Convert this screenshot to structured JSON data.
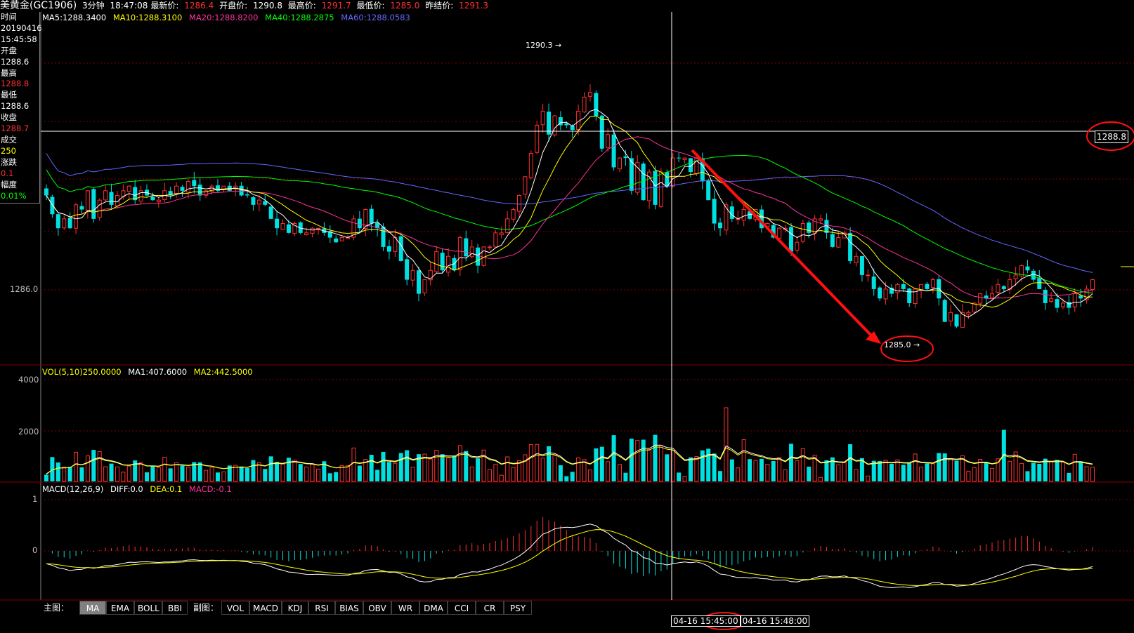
{
  "header": {
    "title": "美黄金(GC1906)",
    "period": "3分钟",
    "time": "18:47:08",
    "latest_label": "最新价:",
    "latest": "1286.4",
    "open_label": "开盘价:",
    "open": "1290.8",
    "high_label": "最高价:",
    "high": "1291.7",
    "low_label": "最低价:",
    "low": "1285.0",
    "prev_label": "昨结价:",
    "prev": "1291.3"
  },
  "info": {
    "time_label": "时间",
    "date": "20190416",
    "clock": "15:45:58",
    "open_label": "开盘",
    "open": "1288.6",
    "high_label": "最高",
    "high": "1288.8",
    "low_label": "最低",
    "low": "1288.6",
    "close_label": "收盘",
    "close": "1288.7",
    "vol_label": "成交",
    "vol": "250",
    "chg_label": "涨跌",
    "chg": "0.1",
    "pct_label": "幅度",
    "pct": "0.01%"
  },
  "legends": {
    "ma5": "MA5:1288.3400",
    "ma10": "MA10:1288.3100",
    "ma20": "MA20:1288.8200",
    "ma40": "MA40:1288.2875",
    "ma60": "MA60:1288.0583",
    "vol": "VOL(5,10)250.0000",
    "vol_ma1": "MA1:407.6000",
    "vol_ma2": "MA2:442.5000",
    "macd": "MACD(12,26,9)",
    "diff": "DIFF:0.0",
    "dea": "DEA:0.1",
    "macd_val": "MACD:-0.1"
  },
  "axis_labels": {
    "price_1286": "1286.0",
    "vol_4000": "4000",
    "vol_2000": "2000",
    "macd_1": "1",
    "macd_0": "0"
  },
  "annotations": {
    "high_mark": "1290.3",
    "low_mark": "1285.0",
    "crosshair_price": "1288.8"
  },
  "buttons": {
    "main_label": "主图：",
    "main": [
      "MA",
      "EMA",
      "BOLL",
      "BBI"
    ],
    "sub_label": "副图：",
    "sub": [
      "VOL",
      "MACD",
      "KDJ",
      "RSI",
      "BIAS",
      "OBV",
      "WR",
      "DMA",
      "CCI",
      "CR",
      "PSY"
    ]
  },
  "timebar": {
    "t1": "04-16 15:45:00",
    "t2": "04-16 15:48:00"
  },
  "colors": {
    "up": "#ff3030",
    "down": "#00e0e0",
    "ma5": "#ffffff",
    "ma10": "#ffff00",
    "ma20": "#ff3399",
    "ma40": "#00ff00",
    "ma60": "#6666ff",
    "grid": "#800000"
  },
  "chart_data": {
    "type": "candlestick",
    "ylim": [
      1284.6,
      1291.9
    ],
    "close": [
      1288.1,
      1287.7,
      1287.4,
      1287.6,
      1287.4,
      1287.9,
      1287.8,
      1288.2,
      1287.6,
      1288.0,
      1288.2,
      1287.9,
      1288.1,
      1288.2,
      1288.3,
      1288.0,
      1288.2,
      1288.1,
      1288.0,
      1288.0,
      1288.2,
      1288.1,
      1288.3,
      1288.2,
      1288.4,
      1288.3,
      1288.1,
      1288.2,
      1288.3,
      1288.2,
      1288.3,
      1288.2,
      1288.3,
      1288.1,
      1288.1,
      1287.9,
      1288.0,
      1287.9,
      1287.6,
      1287.4,
      1287.5,
      1287.3,
      1287.5,
      1287.3,
      1287.3,
      1287.4,
      1287.4,
      1287.3,
      1287.2,
      1287.1,
      1287.2,
      1287.2,
      1287.6,
      1287.4,
      1287.8,
      1287.5,
      1287.4,
      1287.0,
      1286.9,
      1287.2,
      1286.7,
      1286.3,
      1286.5,
      1286.0,
      1286.3,
      1286.5,
      1286.9,
      1286.5,
      1286.8,
      1286.5,
      1287.2,
      1286.8,
      1287.0,
      1286.6,
      1287.0,
      1287.0,
      1287.3,
      1287.3,
      1287.6,
      1287.8,
      1288.1,
      1288.5,
      1289.0,
      1289.6,
      1289.9,
      1289.4,
      1289.8,
      1289.6,
      1289.6,
      1289.5,
      1289.9,
      1290.2,
      1290.3,
      1289.8,
      1289.1,
      1289.4,
      1288.7,
      1288.9,
      1288.9,
      1288.2,
      1288.8,
      1288.0,
      1288.6,
      1287.9,
      1288.6,
      1288.3,
      1288.9,
      1288.9,
      1288.9,
      1288.6,
      1288.9,
      1288.4,
      1288.0,
      1287.5,
      1287.4,
      1287.9,
      1287.6,
      1287.6,
      1287.8,
      1287.6,
      1287.8,
      1287.4,
      1287.5,
      1287.2,
      1287.4,
      1287.4,
      1286.9,
      1287.1,
      1287.5,
      1287.3,
      1287.6,
      1287.6,
      1287.3,
      1287.0,
      1287.2,
      1287.3,
      1286.7,
      1286.8,
      1286.4,
      1286.4,
      1286.1,
      1285.9,
      1286.1,
      1286.0,
      1286.2,
      1286.1,
      1285.8,
      1286.1,
      1286.2,
      1286.1,
      1286.3,
      1285.9,
      1285.4,
      1285.6,
      1285.3,
      1285.6,
      1285.6,
      1285.8,
      1286.0,
      1285.9,
      1286.0,
      1286.2,
      1286.1,
      1286.3,
      1286.4,
      1286.6,
      1286.5,
      1286.3,
      1286.1,
      1285.8,
      1285.9,
      1285.7,
      1285.8,
      1285.7,
      1286.0,
      1285.9,
      1286.1,
      1286.3
    ]
  }
}
